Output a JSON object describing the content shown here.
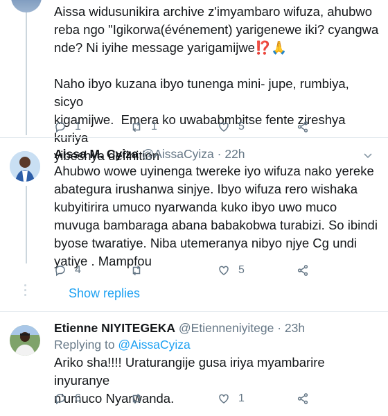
{
  "tweet1": {
    "text": "Aissa widusunikira archive z'imyambaro wifuza, ahubwo\nreba ngo \"Igikorwa(événement) yarigenewe iki? cyangwa\nnde? Ni iyihe message yarigamijwe⁉️🙏\n\nNaho ibyo kuzana ibyo tunenga mini- jupe, rumbiya, sicyo\nkigamijwe.  Emera ko uwababmbitse fente zireshya kuriya\nyibeshya definition",
    "replies": "1",
    "retweets": "1",
    "likes": "5"
  },
  "tweet2": {
    "name": "Aissa M. Cyiza",
    "handle": "@AissaCyiza",
    "time": "· 22h",
    "text": "Ahubwo wowe uyinenga twereke iyo wifuza nako yereke\nabategura irushanwa sinjye. Ibyo wifuza rero wishaka\nkubyitirira umuco nyarwanda kuko ibyo uwo muco\nmuvuga bambaraga abana babakobwa turabizi. So ibindi\nbyose twaratiye. Niba utemeranya nibyo njye Cg undi\nyatiye . Mampfou",
    "replies": "4",
    "retweets": "",
    "likes": "5"
  },
  "show_replies": "Show replies",
  "tweet3": {
    "name": "Etienne NIYITEGEKA",
    "handle": "@Etienneniyitege",
    "time": "· 23h",
    "replying_prefix": "Replying to ",
    "replying_to": "@AissaCyiza",
    "text": "Ariko sha!!!! Uraturangije gusa iriya myambarire inyuranye\nn'umuco Nyarwanda.",
    "replies": "6",
    "retweets": "",
    "likes": "1"
  },
  "colors": {
    "accent": "#1da1f2",
    "muted": "#657786",
    "divider": "#e1e8ed"
  }
}
